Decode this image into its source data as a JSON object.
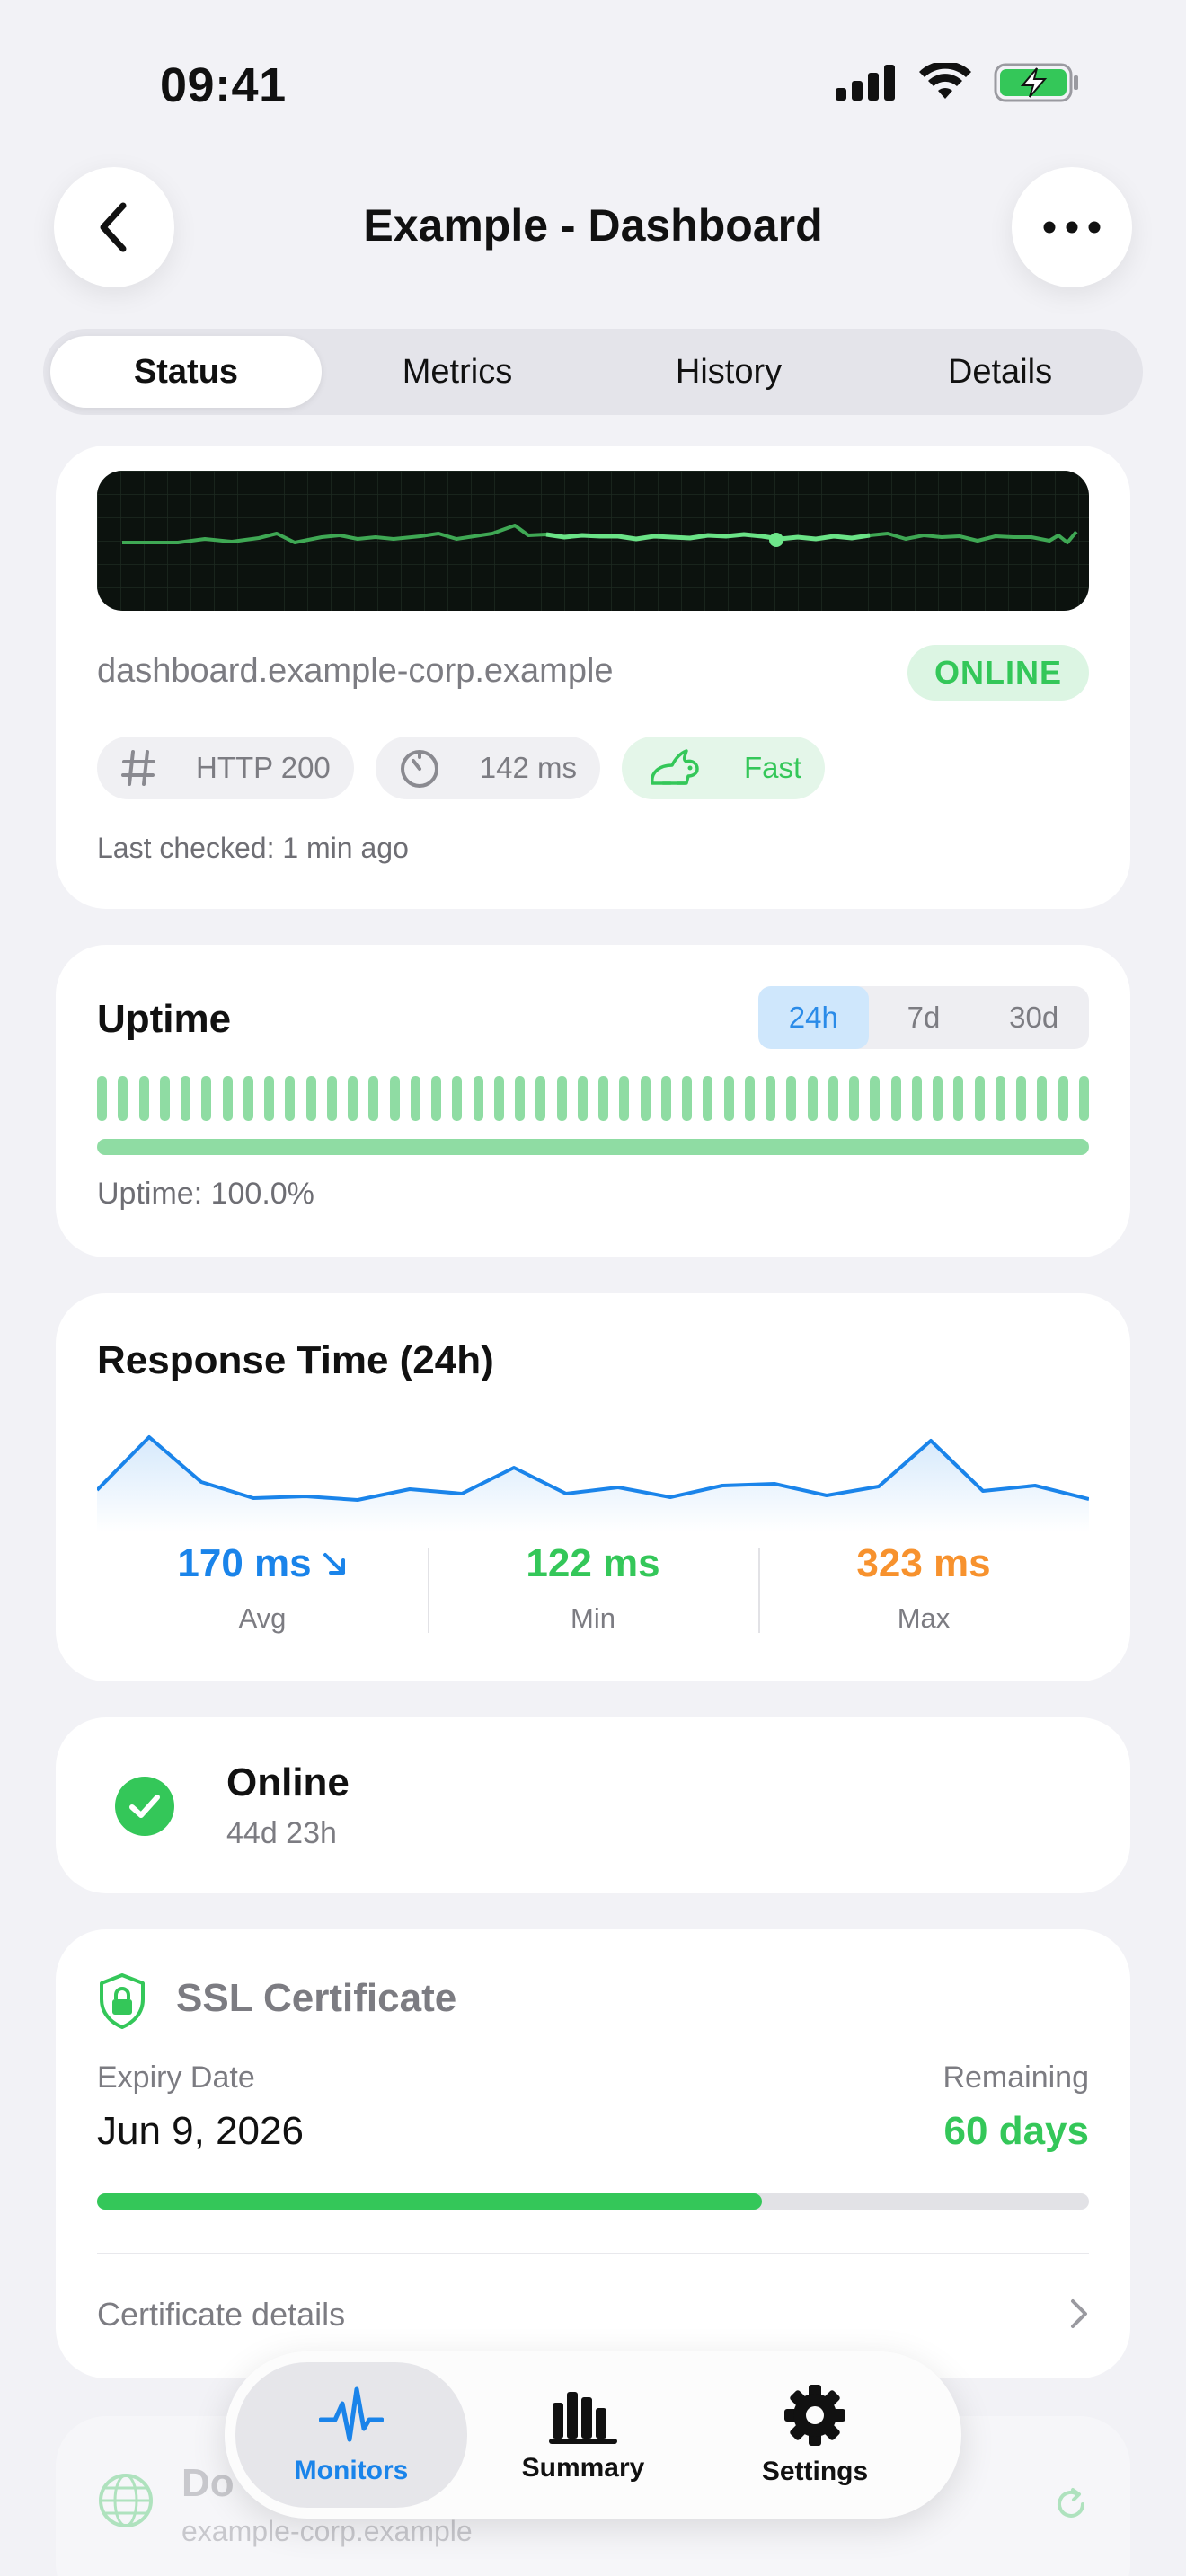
{
  "status_bar": {
    "time": "09:41"
  },
  "nav": {
    "title": "Example - Dashboard"
  },
  "tabs": [
    {
      "label": "Status",
      "active": true
    },
    {
      "label": "Metrics",
      "active": false
    },
    {
      "label": "History",
      "active": false
    },
    {
      "label": "Details",
      "active": false
    }
  ],
  "monitor": {
    "host": "dashboard.example-corp.example",
    "status_badge": "ONLINE",
    "chips": {
      "http": "HTTP 200",
      "latency": "142 ms",
      "speed": "Fast"
    },
    "last_checked": "Last checked: 1 min ago"
  },
  "uptime": {
    "title": "Uptime",
    "ranges": [
      "24h",
      "7d",
      "30d"
    ],
    "active_range": "24h",
    "text": "Uptime: 100.0%",
    "fraction": 1.0
  },
  "response_time": {
    "title": "Response Time (24h)",
    "stats": [
      {
        "value": "170 ms",
        "label": "Avg",
        "color": "#1a84ea"
      },
      {
        "value": "122 ms",
        "label": "Min",
        "color": "#34c759"
      },
      {
        "value": "323 ms",
        "label": "Max",
        "color": "#f7922e"
      }
    ]
  },
  "status_card": {
    "title": "Online",
    "duration": "44d 23h"
  },
  "ssl": {
    "title": "SSL Certificate",
    "expiry_label": "Expiry Date",
    "expiry_value": "Jun 9, 2026",
    "remaining_label": "Remaining",
    "remaining_value": "60 days",
    "remaining_fraction": 0.67,
    "details_link": "Certificate details"
  },
  "ghost_card": {
    "title": "Do",
    "subtitle": "example-corp.example"
  },
  "tabbar": {
    "items": [
      {
        "label": "Monitors",
        "icon": "pulse-icon",
        "active": true
      },
      {
        "label": "Summary",
        "icon": "bar-chart-icon",
        "active": false
      },
      {
        "label": "Settings",
        "icon": "gear-icon",
        "active": false
      }
    ]
  },
  "colors": {
    "accent": "#1a84ea",
    "success": "#34c759",
    "warning": "#f7922e"
  }
}
